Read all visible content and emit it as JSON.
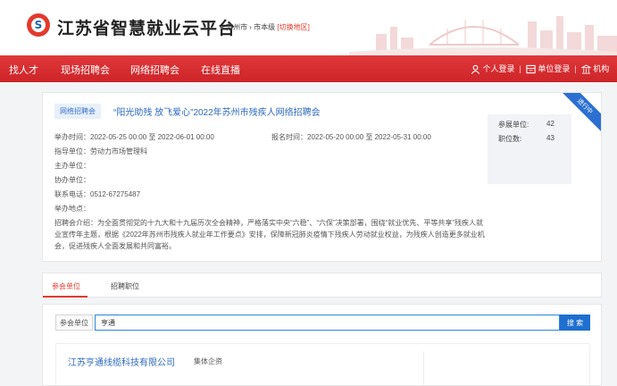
{
  "header": {
    "logo_glyph": "S",
    "site_title": "江苏省智慧就业云平台",
    "location_city": "苏州市 › 市本级",
    "location_switch": "[切换地区]"
  },
  "nav": {
    "items": [
      "找人才",
      "现场招聘会",
      "网络招聘会",
      "在线直播"
    ],
    "personal_login": "个人登录",
    "unit_login": "单位登录",
    "org_login": "机构"
  },
  "fair": {
    "tag": "网络招聘会",
    "title": "“阳光助残 放飞爱心”2022年苏州市残疾人网络招聘会",
    "hold_time": "举办时间：2022-05-25 00:00 至 2022-06-01 00:00",
    "signup_time": "报名时间：2022-05-20 00:00 至 2022-05-31 00:00",
    "guide_unit": "指导单位：劳动力市场管理科",
    "host_unit": "主办单位：",
    "co_unit": "协办单位：",
    "phone": "联系电话：0512-67275487",
    "location": "举办地点：",
    "intro": "招聘会介绍：为全面贯彻党的十九大和十九届历次全会精神，严格落实中央“六稳”、“六保”决策部署，围绕“就业优先、平等共享”残疾人就业宣传年主题，根据《2022年苏州市残疾人就业年工作要点》安排，保障新冠肺炎疫情下残疾人劳动就业权益，为残疾人创造更多就业机会，促进残疾人全面发展和共同富裕。",
    "ribbon": "进行中",
    "stats": [
      {
        "label": "参展单位:",
        "value": "42"
      },
      {
        "label": "职位数:",
        "value": "43"
      }
    ]
  },
  "tabs": [
    "参会单位",
    "招聘职位"
  ],
  "search": {
    "label": "参会单位",
    "value": "亨通",
    "button": "搜 索"
  },
  "results": [
    {
      "name": "江苏亨通线缆科技有限公司",
      "type": "集体企资"
    }
  ],
  "colors": {
    "brand_red": "#e23a2e",
    "link_blue": "#2d69c1",
    "button_blue": "#1e6fd0"
  }
}
